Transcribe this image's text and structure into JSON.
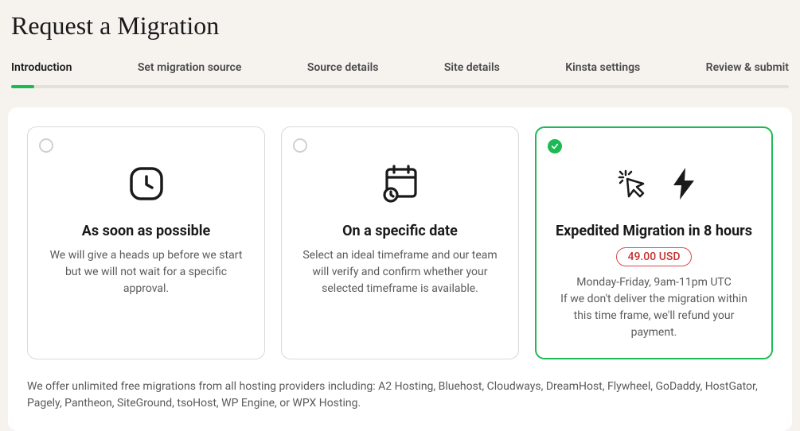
{
  "title": "Request a Migration",
  "tabs": [
    {
      "label": "Introduction",
      "active": true
    },
    {
      "label": "Set migration source"
    },
    {
      "label": "Source details"
    },
    {
      "label": "Site details"
    },
    {
      "label": "Kinsta settings"
    },
    {
      "label": "Review & submit"
    }
  ],
  "options": [
    {
      "title": "As soon as possible",
      "desc": "We will give a heads up before we start but we will not wait for a specific approval.",
      "selected": false
    },
    {
      "title": "On a specific date",
      "desc": "Select an ideal timeframe and our team will verify and confirm whether your selected timeframe is available.",
      "selected": false
    },
    {
      "title": "Expedited Migration in 8 hours",
      "price": "49.00 USD",
      "subhead": "Monday-Friday, 9am-11pm UTC",
      "desc": "If we don't deliver the migration within this time frame, we'll refund your payment.",
      "selected": true
    }
  ],
  "footnote": "We offer unlimited free migrations from all hosting providers including: A2 Hosting, Bluehost, Cloudways, DreamHost, Flywheel, GoDaddy, HostGator, Pagely, Pantheon, SiteGround, tsoHost, WP Engine, or WPX Hosting."
}
